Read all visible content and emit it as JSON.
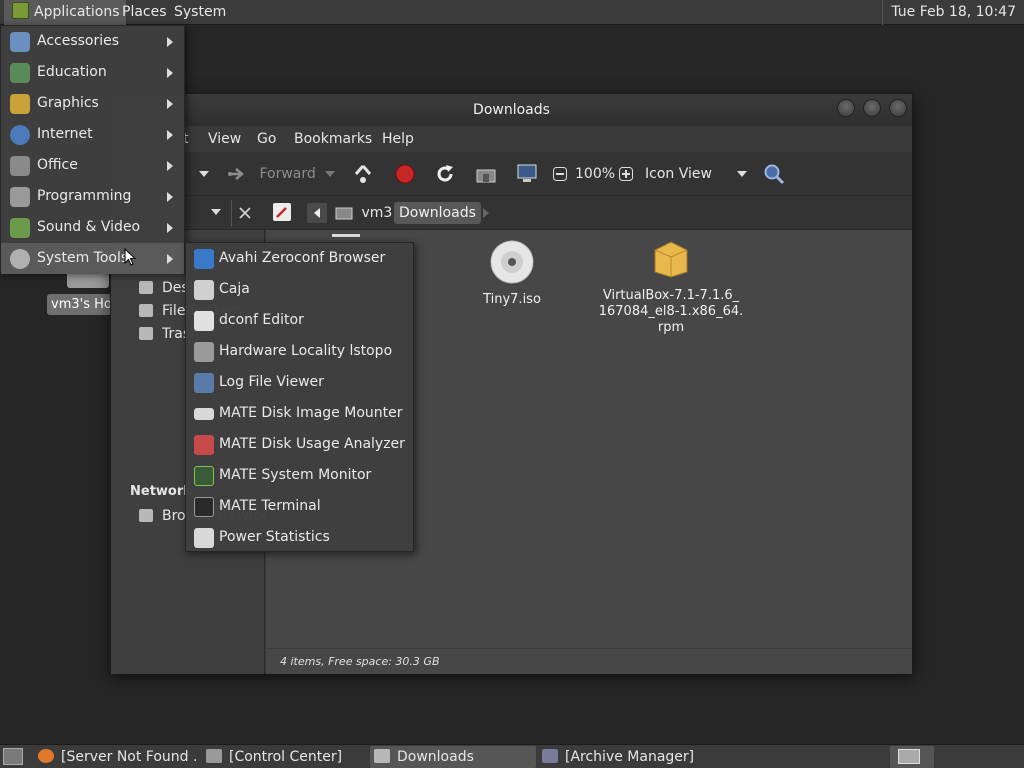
{
  "top_panel": {
    "applications": "Applications",
    "places": "Places",
    "system": "System",
    "clock": "Tue Feb 18, 10:47"
  },
  "desktop": {
    "home_label": "vm3's Home"
  },
  "window": {
    "title": "Downloads",
    "menu": [
      "t",
      "View",
      "Go",
      "Bookmarks",
      "Help"
    ],
    "toolbar": {
      "forward": "Forward",
      "zoom": "100%",
      "view_mode": "Icon View"
    },
    "path": [
      "vm3",
      "Downloads"
    ],
    "sidebar": {
      "items": [
        "Desktop",
        "File System",
        "Trash"
      ],
      "network_heading": "Network",
      "network_items": [
        "Browse Network"
      ]
    },
    "files": [
      {
        "name": "Tiny7.iso",
        "icon": "disc-icon"
      },
      {
        "name": "VirtualBox-7.1-7.1.6_167084_el8-1.x86_64.rpm",
        "lines": [
          "VirtualBox-7.1-7.1.6_",
          "167084_el8-1.x86_64.",
          "rpm"
        ],
        "icon": "package-icon"
      }
    ],
    "status": "4 items, Free space: 30.3 GB"
  },
  "apps_menu": [
    {
      "label": "Accessories",
      "icon": "accessories-icon",
      "color": "#6b8fbf"
    },
    {
      "label": "Education",
      "icon": "education-icon",
      "color": "#5a8a5a"
    },
    {
      "label": "Graphics",
      "icon": "graphics-icon",
      "color": "#c9a23a"
    },
    {
      "label": "Internet",
      "icon": "internet-icon",
      "color": "#4a7ab8"
    },
    {
      "label": "Office",
      "icon": "office-icon",
      "color": "#8a8a8a"
    },
    {
      "label": "Programming",
      "icon": "programming-icon",
      "color": "#9a9a9a"
    },
    {
      "label": "Sound & Video",
      "icon": "sound-video-icon",
      "color": "#6a9a4a"
    },
    {
      "label": "System Tools",
      "icon": "system-tools-icon",
      "color": "#b0b0b0"
    }
  ],
  "system_tools_menu": [
    {
      "label": "Avahi Zeroconf Browser",
      "icon": "avahi-icon",
      "color": "#3a7ac8"
    },
    {
      "label": "Caja",
      "icon": "caja-icon",
      "color": "#cfcfcf"
    },
    {
      "label": "dconf Editor",
      "icon": "dconf-icon",
      "color": "#e0e0e0"
    },
    {
      "label": "Hardware Locality lstopo",
      "icon": "hardware-icon",
      "color": "#9a9a9a"
    },
    {
      "label": "Log File Viewer",
      "icon": "log-viewer-icon",
      "color": "#5a7aaa"
    },
    {
      "label": "MATE Disk Image Mounter",
      "icon": "disk-mounter-icon",
      "color": "#d8d8d8"
    },
    {
      "label": "MATE Disk Usage Analyzer",
      "icon": "disk-usage-icon",
      "color": "#c84a4a"
    },
    {
      "label": "MATE System Monitor",
      "icon": "system-monitor-icon",
      "color": "#3a5a3a"
    },
    {
      "label": "MATE Terminal",
      "icon": "terminal-icon",
      "color": "#2a2a2a"
    },
    {
      "label": "Power Statistics",
      "icon": "power-stats-icon",
      "color": "#d8d8d8"
    }
  ],
  "taskbar": [
    {
      "label": "[Server Not Found ...",
      "icon": "firefox-icon",
      "color": "#e07a2a"
    },
    {
      "label": "[Control Center]",
      "icon": "control-center-icon",
      "color": "#9a9a9a"
    },
    {
      "label": "Downloads",
      "icon": "folder-icon",
      "color": "#b8b8b8"
    },
    {
      "label": "[Archive Manager]",
      "icon": "archive-icon",
      "color": "#7a7a9a"
    }
  ]
}
